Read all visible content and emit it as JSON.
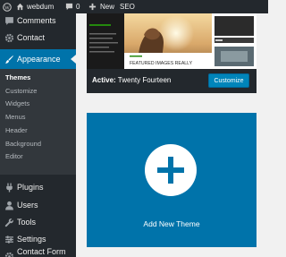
{
  "adminbar": {
    "site_name": "webdum",
    "comments_count": "0",
    "new_label": "New",
    "seo_label": "SEO"
  },
  "sidebar": {
    "items": [
      {
        "label": "Comments",
        "icon": "comment-icon"
      },
      {
        "label": "Contact",
        "icon": "gear-icon"
      },
      {
        "label": "Appearance",
        "icon": "paintbrush-icon",
        "active": true
      },
      {
        "label": "Plugins",
        "icon": "plugin-icon"
      },
      {
        "label": "Users",
        "icon": "user-icon"
      },
      {
        "label": "Tools",
        "icon": "wrench-icon"
      },
      {
        "label": "Settings",
        "icon": "settings-icon"
      },
      {
        "label": "Contact Form DB",
        "icon": "gear-icon"
      }
    ],
    "submenu": [
      "Themes",
      "Customize",
      "Widgets",
      "Menus",
      "Header",
      "Background",
      "Editor"
    ]
  },
  "theme": {
    "active_prefix": "Active:",
    "name": "Twenty Fourteen",
    "customize_label": "Customize",
    "featured_text": "FEATURED IMAGES REALLY"
  },
  "add_new": {
    "label": "Add New Theme"
  },
  "colors": {
    "accent": "#0073aa",
    "admin_dark": "#23282d",
    "button": "#0085ba"
  }
}
